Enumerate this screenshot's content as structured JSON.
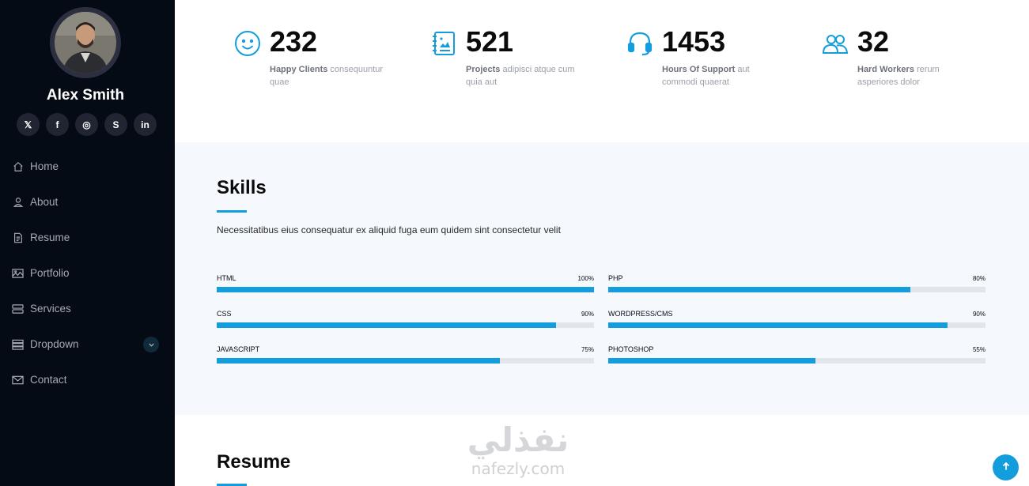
{
  "profile": {
    "name": "Alex Smith"
  },
  "socials": [
    {
      "name": "x-icon",
      "glyph": "𝕏"
    },
    {
      "name": "facebook-icon",
      "glyph": "f"
    },
    {
      "name": "instagram-icon",
      "glyph": "◎"
    },
    {
      "name": "skype-icon",
      "glyph": "S"
    },
    {
      "name": "linkedin-icon",
      "glyph": "in"
    }
  ],
  "nav": [
    {
      "label": "Home",
      "icon": "house-icon"
    },
    {
      "label": "About",
      "icon": "person-icon"
    },
    {
      "label": "Resume",
      "icon": "file-text-icon"
    },
    {
      "label": "Portfolio",
      "icon": "images-icon"
    },
    {
      "label": "Services",
      "icon": "hdd-stack-icon"
    },
    {
      "label": "Dropdown",
      "icon": "menu-icon"
    },
    {
      "label": "Contact",
      "icon": "envelope-icon"
    }
  ],
  "stats": [
    {
      "number": "232",
      "title": "Happy Clients",
      "text": "consequuntur quae",
      "icon": "emoji-smile-icon"
    },
    {
      "number": "521",
      "title": "Projects",
      "text": "adipisci atque cum quia aut",
      "icon": "journal-richtext-icon"
    },
    {
      "number": "1453",
      "title": "Hours Of Support",
      "text": "aut commodi quaerat",
      "icon": "headset-icon"
    },
    {
      "number": "32",
      "title": "Hard Workers",
      "text": "rerum asperiores dolor",
      "icon": "people-icon"
    }
  ],
  "skills": {
    "title": "Skills",
    "description": "Necessitatibus eius consequatur ex aliquid fuga eum quidem sint consectetur velit",
    "items": [
      {
        "name": "HTML",
        "value_label": "100%",
        "value": 100
      },
      {
        "name": "PHP",
        "value_label": "80%",
        "value": 80
      },
      {
        "name": "CSS",
        "value_label": "90%",
        "value": 90
      },
      {
        "name": "WORDPRESS/CMS",
        "value_label": "90%",
        "value": 90
      },
      {
        "name": "JAVASCRIPT",
        "value_label": "75%",
        "value": 75
      },
      {
        "name": "PHOTOSHOP",
        "value_label": "55%",
        "value": 55
      }
    ]
  },
  "resume": {
    "title": "Resume"
  },
  "watermark": {
    "arabic": "نفذلي",
    "latin": "nafezly.com"
  },
  "colors": {
    "accent": "#149ddd",
    "sidebar_bg": "#040b14",
    "section_bg": "#f5f8fd"
  }
}
